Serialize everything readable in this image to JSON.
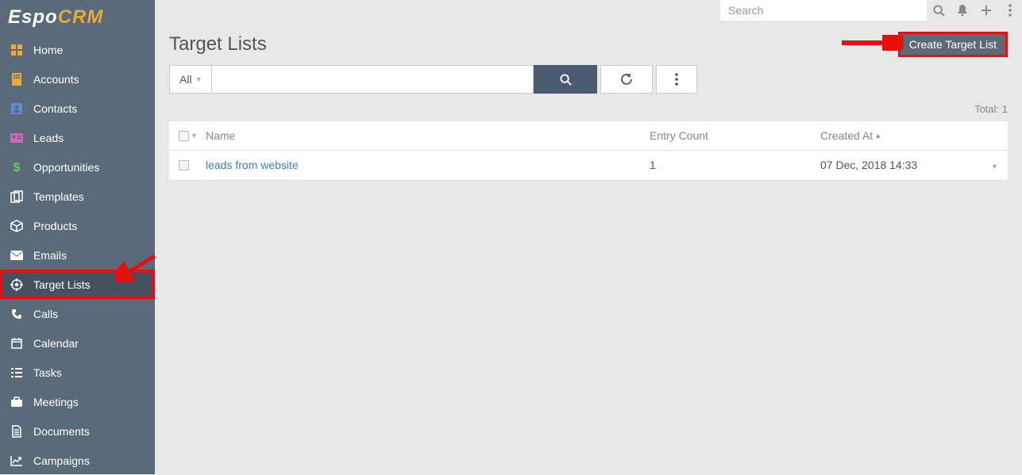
{
  "brand": {
    "part1": "Espo",
    "part2": "CRM"
  },
  "sidebar": {
    "items": [
      {
        "label": "Home",
        "icon": "home"
      },
      {
        "label": "Accounts",
        "icon": "building"
      },
      {
        "label": "Contacts",
        "icon": "address-card"
      },
      {
        "label": "Leads",
        "icon": "id-card"
      },
      {
        "label": "Opportunities",
        "icon": "dollar"
      },
      {
        "label": "Templates",
        "icon": "copy"
      },
      {
        "label": "Products",
        "icon": "cube"
      },
      {
        "label": "Emails",
        "icon": "envelope"
      },
      {
        "label": "Target Lists",
        "icon": "crosshairs",
        "active": true,
        "highlighted": true
      },
      {
        "label": "Calls",
        "icon": "phone"
      },
      {
        "label": "Calendar",
        "icon": "calendar"
      },
      {
        "label": "Tasks",
        "icon": "tasks"
      },
      {
        "label": "Meetings",
        "icon": "briefcase"
      },
      {
        "label": "Documents",
        "icon": "file"
      },
      {
        "label": "Campaigns",
        "icon": "chart-line"
      }
    ]
  },
  "topbar": {
    "search_placeholder": "Search"
  },
  "page": {
    "title": "Target Lists",
    "create_button": "Create Target List",
    "filter_label": "All",
    "total_label": "Total:",
    "total_count": "1"
  },
  "table": {
    "headers": {
      "name": "Name",
      "entry": "Entry Count",
      "created": "Created At"
    },
    "rows": [
      {
        "name": "leads from website",
        "entry": "1",
        "created": "07 Dec, 2018 14:33"
      }
    ]
  }
}
